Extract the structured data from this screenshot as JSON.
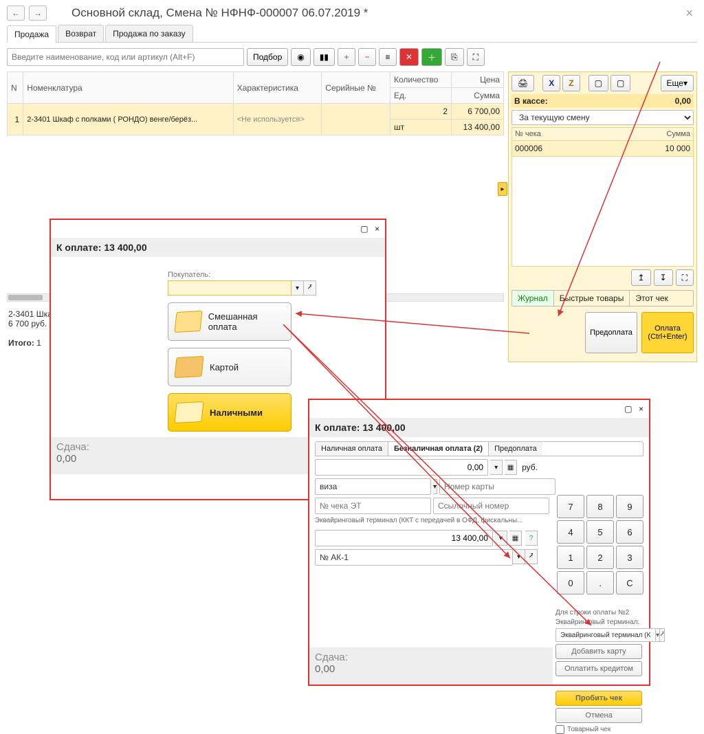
{
  "header": {
    "title": "Основной склад, Смена № НФНФ-000007  06.07.2019 *"
  },
  "tabs": {
    "sale": "Продажа",
    "return": "Возврат",
    "order_sale": "Продажа по заказу"
  },
  "toolbar": {
    "search_placeholder": "Введите наименование, код или артикул (Alt+F)",
    "select": "Подбор"
  },
  "grid": {
    "headers": {
      "n": "N",
      "nomen": "Номенклатура",
      "char": "Характеристика",
      "serial": "Серийные №",
      "qty": "Количество",
      "price": "Цена",
      "unit": "Ед.",
      "sum": "Сумма"
    },
    "rows": [
      {
        "n": "1",
        "nomen": "2-3401 Шкаф с полками ( РОНДО) венге/берёз...",
        "char": "<Не используется>",
        "qty": "2",
        "unit": "шт",
        "price": "6 700,00",
        "sum": "13 400,00"
      }
    ]
  },
  "right": {
    "cash_label": "В кассе:",
    "cash_value": "0,00",
    "shift": "За текущую смену",
    "more": "Еще",
    "chk_no": "№ чека",
    "chk_sum": "Сумма",
    "row_no": "000006",
    "row_sum": "10 000",
    "tabs": {
      "journal": "Журнал",
      "fast": "Быстрые товары",
      "thischeck": "Этот чек"
    },
    "prepay": "Предоплата",
    "pay": "Оплата (Ctrl+Enter)"
  },
  "summary": {
    "line1": "2-3401 Шка",
    "line2": "6 700 руб.",
    "total_label": "Итого:",
    "total": "1"
  },
  "dlg1": {
    "total_label": "К оплате: 13 400,00",
    "buyer": "Покупатель:",
    "mixed": "Смешанная оплата",
    "card": "Картой",
    "cash": "Наличными",
    "change": "Сдача:",
    "change_val": "0,00"
  },
  "dlg2": {
    "total_label": "К оплате: 13 400,00",
    "tabs": {
      "cash": "Наличная оплата",
      "noncash": "Безналичная оплата (2)",
      "prepay": "Предоплата"
    },
    "amount1": "0,00",
    "rub": "руб.",
    "visa": "виза",
    "card_ph": "Номер карты",
    "et_ph": "№ чека ЭТ",
    "ref_ph": "Ссылочный номер",
    "term_label": "Эквайринговый терминал  (ККТ с передачей в ОФД, фискальны...",
    "amount2": "13 400,00",
    "acct": "№ АК-1",
    "side_line": "Для строки оплаты №2",
    "side_term": "Эквайринговый терминал:",
    "side_term_val": "Эквайринговый терминал (К",
    "add_card": "Добавить карту",
    "pay_credit": "Оплатить кредитом",
    "receipt": "Пробить чек",
    "cancel": "Отмена",
    "goods": "Товарный чек",
    "change": "Сдача:",
    "change_val": "0,00"
  },
  "keypad": [
    "7",
    "8",
    "9",
    "4",
    "5",
    "6",
    "1",
    "2",
    "3",
    "0",
    ".",
    "C"
  ]
}
